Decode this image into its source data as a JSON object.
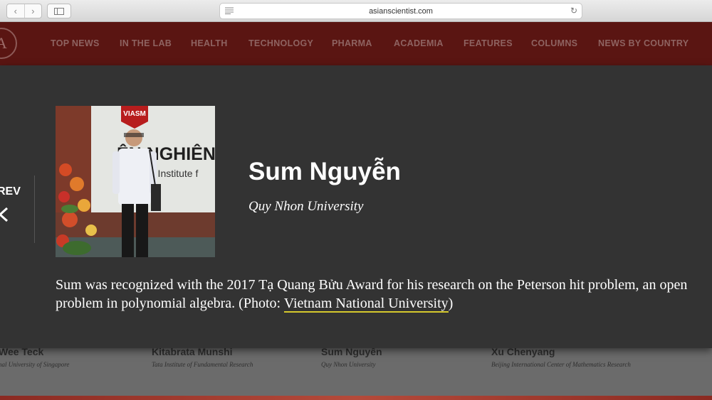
{
  "browser": {
    "url": "asianscientist.com",
    "back_icon": "chevron-left-icon",
    "forward_icon": "chevron-right-icon",
    "sidebar_icon": "sidebar-icon",
    "reload_icon": "reload-icon"
  },
  "site": {
    "logo_letter": "A",
    "brand_color": "#5a1512",
    "nav": [
      {
        "label": "TOP NEWS"
      },
      {
        "label": "IN THE LAB"
      },
      {
        "label": "HEALTH"
      },
      {
        "label": "TECHNOLOGY"
      },
      {
        "label": "PHARMA"
      },
      {
        "label": "ACADEMIA"
      },
      {
        "label": "FEATURES"
      },
      {
        "label": "COLUMNS"
      },
      {
        "label": "NEWS BY COUNTRY"
      }
    ]
  },
  "overlay": {
    "prev_label": "REV",
    "name": "Sum Nguyễn",
    "affiliation": "Quy Nhon University",
    "caption_text": "Sum was recognized with the 2017 Tạ Quang Bửu Award for his research on the Peterson hit problem, an open problem in polynomial algebra. (Photo: ",
    "caption_link": "Vietnam National University",
    "caption_end": ")",
    "photo": {
      "sign_text": "VIASM",
      "wall_line1": "ỆN NGHIÊN",
      "wall_line2": "m Institute f"
    }
  },
  "background_cards": [
    {
      "name": "Wee Teck",
      "affiliation": "nal University of Singapore"
    },
    {
      "name": "Kitabrata Munshi",
      "affiliation": "Tata Institute of Fundamental Research"
    },
    {
      "name": "Sum Nguyễn",
      "affiliation": "Quy Nhon University"
    },
    {
      "name": "Xu Chenyang",
      "affiliation": "Beijing International Center of Mathematics Research"
    }
  ]
}
